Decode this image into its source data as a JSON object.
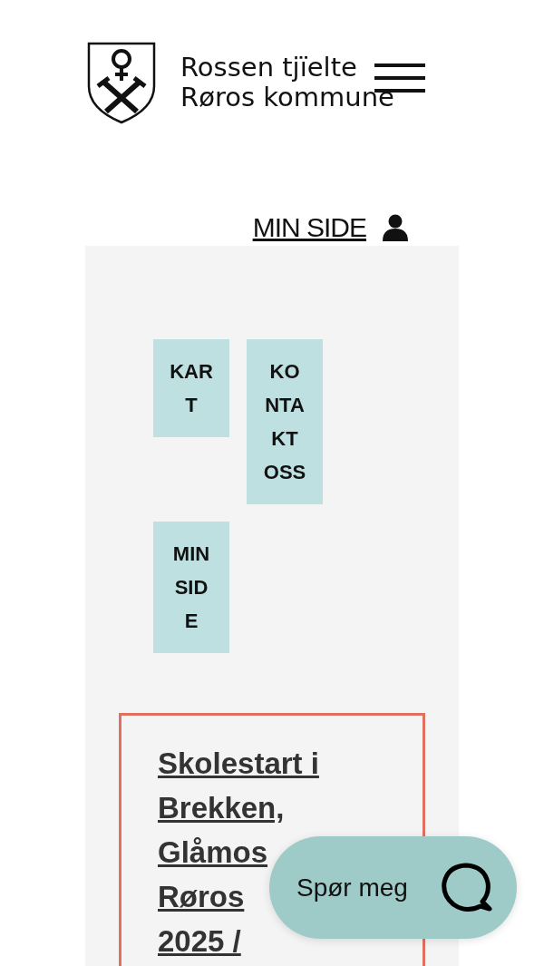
{
  "logo": {
    "lines": [
      "Rossen tjïelte",
      "Røros kommune"
    ]
  },
  "header_link": {
    "label": "MIN SIDE"
  },
  "tiles": [
    {
      "label": "KART"
    },
    {
      "label": "KONTAKT OSS"
    },
    {
      "label": "MIN SIDE"
    }
  ],
  "article": {
    "title_lines": [
      "Skolestart i",
      "Brekken,",
      "Glåmos",
      "Røros",
      "2025 /"
    ]
  },
  "chat_button": {
    "label": "Spør meg"
  }
}
